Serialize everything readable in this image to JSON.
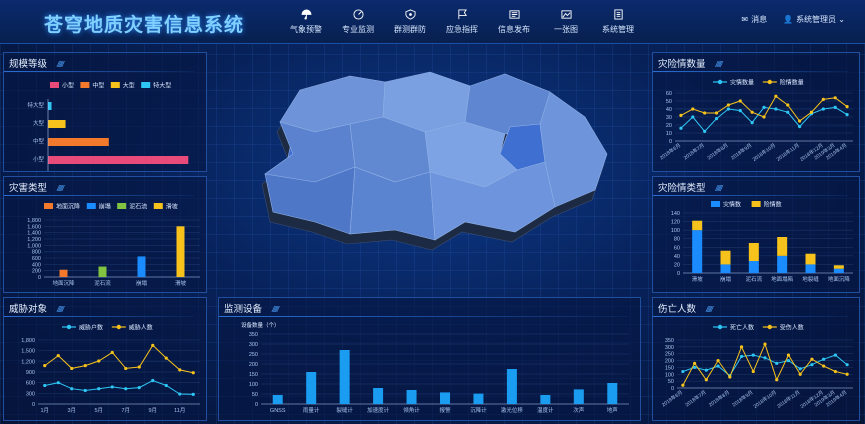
{
  "app": {
    "title": "苍穹地质灾害信息系统"
  },
  "nav": [
    {
      "label": "气象预警",
      "icon": "umbrella-icon"
    },
    {
      "label": "专业监测",
      "icon": "gauge-icon"
    },
    {
      "label": "群测群防",
      "icon": "shield-icon"
    },
    {
      "label": "应急指挥",
      "icon": "flag-icon"
    },
    {
      "label": "信息发布",
      "icon": "newspaper-icon"
    },
    {
      "label": "一张图",
      "icon": "map-icon"
    },
    {
      "label": "系统管理",
      "icon": "settings-doc-icon"
    }
  ],
  "user": {
    "messages": "消息",
    "account": "系统管理员"
  },
  "colors": {
    "cyan": "#2ec7f5",
    "yellow": "#f7c21b",
    "orange": "#f37a2c",
    "green": "#82c341",
    "pink": "#e84a7a",
    "blue": "#1a8cff"
  },
  "panels": {
    "scale": "规模等级",
    "disaster": "灾害类型",
    "threat": "威胁对象",
    "monitor": "监测设备",
    "danger_count": "灾险情数量",
    "danger_type": "灾险情类型",
    "casualty": "伤亡人数"
  },
  "chart_data": [
    {
      "id": "scale",
      "type": "bar",
      "orientation": "horizontal",
      "series": [
        {
          "name": "小型",
          "color": "#e84a7a"
        },
        {
          "name": "中型",
          "color": "#f37a2c"
        },
        {
          "name": "大型",
          "color": "#f7c21b"
        },
        {
          "name": "特大型",
          "color": "#2ec7f5"
        }
      ],
      "categories": [
        "特大型",
        "大型",
        "中型",
        "小型"
      ],
      "values": [
        3,
        15,
        52,
        120
      ],
      "xlim": [
        0,
        130
      ]
    },
    {
      "id": "disaster",
      "type": "bar",
      "series": [
        {
          "name": "地面沉降",
          "color": "#f37a2c"
        },
        {
          "name": "崩塌",
          "color": "#1a8cff"
        },
        {
          "name": "泥石流",
          "color": "#82c341"
        },
        {
          "name": "滑坡",
          "color": "#f7c21b"
        }
      ],
      "categories": [
        "地面沉降",
        "泥石流",
        "崩塌",
        "滑坡"
      ],
      "values": [
        230,
        330,
        650,
        1600
      ],
      "ylim": [
        0,
        1800
      ],
      "yticks": [
        "0",
        "200",
        "400",
        "600",
        "800",
        "1,000",
        "1,200",
        "1,400",
        "1,600",
        "1,800"
      ]
    },
    {
      "id": "threat",
      "type": "line",
      "series": [
        {
          "name": "威胁户数",
          "color": "#2ec7f5",
          "values": [
            520,
            600,
            430,
            380,
            430,
            480,
            430,
            460,
            660,
            520,
            280,
            270
          ]
        },
        {
          "name": "威胁人数",
          "color": "#f7c21b",
          "values": [
            1080,
            1360,
            1000,
            1080,
            1210,
            1450,
            1000,
            1040,
            1650,
            1290,
            960,
            880
          ]
        }
      ],
      "x": [
        "1月",
        "2月",
        "3月",
        "4月",
        "5月",
        "6月",
        "7月",
        "8月",
        "9月",
        "10月",
        "11月",
        "12月"
      ],
      "xticks": [
        "1月",
        "3月",
        "5月",
        "7月",
        "9月",
        "11月"
      ],
      "ylim": [
        0,
        1800
      ],
      "yticks": [
        "0",
        "300",
        "600",
        "900",
        "1,200",
        "1,500",
        "1,800"
      ]
    },
    {
      "id": "monitor",
      "type": "bar",
      "ylabel": "设备数量（个）",
      "categories": [
        "GNSS",
        "雨量计",
        "裂缝计",
        "加速度计",
        "倾角计",
        "报警",
        "沉降计",
        "激光位移",
        "温度计",
        "次声",
        "地声"
      ],
      "values": [
        45,
        160,
        270,
        80,
        70,
        58,
        52,
        175,
        45,
        73,
        105
      ],
      "ylim": [
        0,
        350
      ],
      "yticks": [
        "0",
        "50",
        "100",
        "150",
        "200",
        "250",
        "300",
        "350"
      ]
    },
    {
      "id": "danger_count",
      "type": "line",
      "series": [
        {
          "name": "灾情数量",
          "color": "#2ec7f5",
          "values": [
            16,
            30,
            12,
            28,
            40,
            38,
            23,
            42,
            40,
            36,
            18,
            34,
            40,
            42,
            33
          ]
        },
        {
          "name": "险情数量",
          "color": "#f7c21b",
          "values": [
            32,
            40,
            35,
            35,
            45,
            50,
            36,
            30,
            56,
            45,
            25,
            36,
            52,
            54,
            43
          ]
        }
      ],
      "x": [
        "2018年6月",
        "",
        "2018年7月",
        "",
        "2018年8月",
        "",
        "2018年9月",
        "",
        "2018年10月",
        "",
        "2018年11月",
        "",
        "2018年12月",
        "2019年3月",
        "2019年4月"
      ],
      "xticks": [
        "2018年6月",
        "2018年7月",
        "2018年8月",
        "2018年9月",
        "2018年10月",
        "2018年11月",
        "2018年12月",
        "2019年3月",
        "2019年4月"
      ],
      "ylim": [
        0,
        60
      ],
      "yticks": [
        "0",
        "10",
        "20",
        "30",
        "40",
        "50",
        "60"
      ]
    },
    {
      "id": "danger_type",
      "type": "bar",
      "stacked": true,
      "series": [
        {
          "name": "灾情数",
          "color": "#1a8cff",
          "values": [
            100,
            20,
            28,
            40,
            20,
            10
          ]
        },
        {
          "name": "险情数",
          "color": "#f7c21b",
          "values": [
            22,
            32,
            42,
            44,
            25,
            8
          ]
        }
      ],
      "categories": [
        "滑坡",
        "崩塌",
        "泥石流",
        "地面塌陷",
        "地裂缝",
        "地面沉降"
      ],
      "ylim": [
        0,
        140
      ],
      "yticks": [
        "0",
        "20",
        "40",
        "60",
        "80",
        "100",
        "120",
        "140"
      ]
    },
    {
      "id": "casualty",
      "type": "line",
      "series": [
        {
          "name": "死亡人数",
          "color": "#2ec7f5",
          "values": [
            120,
            150,
            130,
            160,
            90,
            230,
            240,
            220,
            180,
            200,
            140,
            170,
            210,
            240,
            170
          ]
        },
        {
          "name": "受伤人数",
          "color": "#f7c21b",
          "values": [
            20,
            180,
            60,
            200,
            80,
            300,
            120,
            320,
            60,
            240,
            100,
            210,
            160,
            120,
            100
          ]
        }
      ],
      "x": [
        "2018年6月",
        "",
        "2018年7月",
        "",
        "2018年8月",
        "",
        "2018年9月",
        "",
        "2018年10月",
        "",
        "2018年11月",
        "",
        "2018年12月",
        "2019年3月",
        "2019年4月"
      ],
      "xticks": [
        "2018年6月",
        "2018年7月",
        "2018年8月",
        "2018年9月",
        "2018年10月",
        "2018年11月",
        "2018年12月",
        "2019年3月",
        "2019年4月"
      ],
      "ylim": [
        0,
        350
      ],
      "yticks": [
        "0",
        "50",
        "100",
        "150",
        "200",
        "250",
        "300",
        "350"
      ]
    }
  ]
}
